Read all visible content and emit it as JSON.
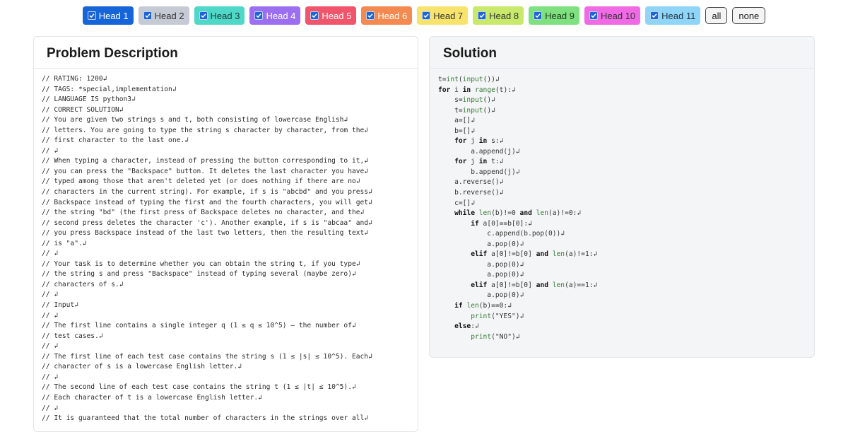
{
  "heads": [
    {
      "label": "Head 1",
      "bg": "#1565d8",
      "fg": "#ffffff"
    },
    {
      "label": "Head 2",
      "bg": "#c5cad4",
      "fg": "#333333"
    },
    {
      "label": "Head 3",
      "bg": "#4fd8c8",
      "fg": "#1e3a3a"
    },
    {
      "label": "Head 4",
      "bg": "#9b6ff0",
      "fg": "#ffffff"
    },
    {
      "label": "Head 5",
      "bg": "#f0556b",
      "fg": "#ffffff"
    },
    {
      "label": "Head 6",
      "bg": "#f48a4f",
      "fg": "#ffffff"
    },
    {
      "label": "Head 7",
      "bg": "#f8e46a",
      "fg": "#333333"
    },
    {
      "label": "Head 8",
      "bg": "#c8e96a",
      "fg": "#333333"
    },
    {
      "label": "Head 9",
      "bg": "#7ee07e",
      "fg": "#1e3a1e"
    },
    {
      "label": "Head 10",
      "bg": "#ef6ae4",
      "fg": "#333333"
    },
    {
      "label": "Head 11",
      "bg": "#8fd5f8",
      "fg": "#1e3340"
    }
  ],
  "controls": {
    "all_label": "all",
    "none_label": "none"
  },
  "problem": {
    "title": "Problem Description",
    "lines": [
      "// RATING: 1200↲",
      "// TAGS: *special,implementation↲",
      "// LANGUAGE IS python3↲",
      "// CORRECT SOLUTION↲",
      "// You are given two strings s and t, both consisting of lowercase English↲",
      "// letters. You are going to type the string s character by character, from the↲",
      "// first character to the last one.↲",
      "// ↲",
      "// When typing a character, instead of pressing the button corresponding to it,↲",
      "// you can press the \"Backspace\" button. It deletes the last character you have↲",
      "// typed among those that aren't deleted yet (or does nothing if there are no↲",
      "// characters in the current string). For example, if s is \"abcbd\" and you press↲",
      "// Backspace instead of typing the first and the fourth characters, you will get↲",
      "// the string \"bd\" (the first press of Backspace deletes no character, and the↲",
      "// second press deletes the character 'c'). Another example, if s is \"abcaa\" and↲",
      "// you press Backspace instead of the last two letters, then the resulting text↲",
      "// is \"a\".↲",
      "// ↲",
      "// Your task is to determine whether you can obtain the string t, if you type↲",
      "// the string s and press \"Backspace\" instead of typing several (maybe zero)↲",
      "// characters of s.↲",
      "// ↲",
      "// Input↲",
      "// ↲",
      "// The first line contains a single integer q (1 ≤ q ≤ 10^5) — the number of↲",
      "// test cases.↲",
      "// ↲",
      "// The first line of each test case contains the string s (1 ≤ |s| ≤ 10^5). Each↲",
      "// character of s is a lowercase English letter.↲",
      "// ↲",
      "// The second line of each test case contains the string t (1 ≤ |t| ≤ 10^5).↲",
      "// Each character of t is a lowercase English letter.↲",
      "// ↲",
      "// It is guaranteed that the total number of characters in the strings over all↲"
    ]
  },
  "solution": {
    "title": "Solution",
    "lines": [
      "t=int(input())↲",
      "for i in range(t):↲",
      "    s=input()↲",
      "    t=input()↲",
      "    a=[]↲",
      "    b=[]↲",
      "    for j in s:↲",
      "        a.append(j)↲",
      "    for j in t:↲",
      "        b.append(j)↲",
      "    a.reverse()↲",
      "    b.reverse()↲",
      "    c=[]↲",
      "    while len(b)!=0 and len(a)!=0:↲",
      "        if a[0]==b[0]:↲",
      "            c.append(b.pop(0))↲",
      "            a.pop(0)↲",
      "        elif a[0]!=b[0] and len(a)!=1:↲",
      "            a.pop(0)↲",
      "            a.pop(0)↲",
      "        elif a[0]!=b[0] and len(a)==1:↲",
      "            a.pop(0)↲",
      "    if len(b)==0:↲",
      "        print(\"YES\")↲",
      "    else:↲",
      "        print(\"NO\")↲"
    ]
  }
}
